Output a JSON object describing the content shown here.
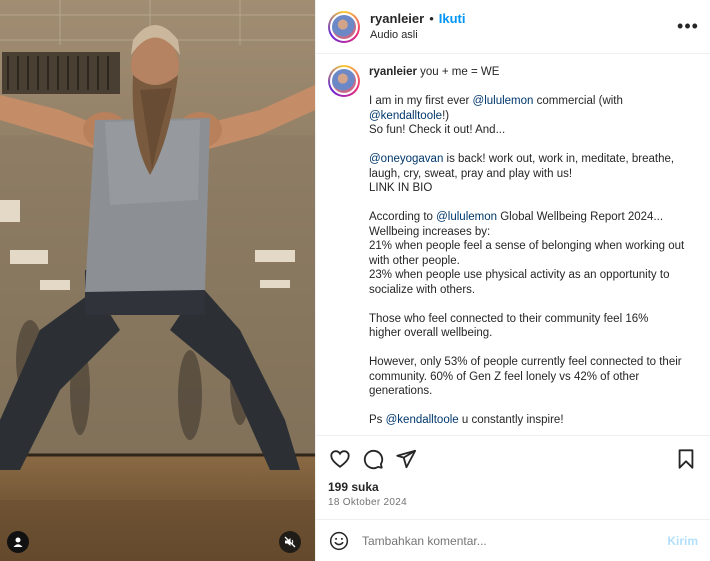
{
  "post": {
    "username": "ryanleier",
    "separator": "•",
    "follow_label": "Ikuti",
    "audio_label": "Audio asli",
    "more_label": "•••"
  },
  "caption": {
    "username": "ryanleier",
    "lines": [
      {
        "segments": [
          {
            "text": " you + me = WE",
            "type": "text"
          }
        ]
      },
      {
        "segments": [
          {
            "text": "",
            "type": "text"
          }
        ]
      },
      {
        "segments": [
          {
            "text": "I am in my first ever ",
            "type": "text"
          },
          {
            "text": "@lululemon",
            "type": "mention"
          },
          {
            "text": " commercial (with",
            "type": "text"
          }
        ]
      },
      {
        "segments": [
          {
            "text": "@kendalltoole",
            "type": "mention"
          },
          {
            "text": "!)",
            "type": "text"
          }
        ]
      },
      {
        "segments": [
          {
            "text": "So fun! Check it out! And...",
            "type": "text"
          }
        ]
      },
      {
        "segments": [
          {
            "text": "",
            "type": "text"
          }
        ]
      },
      {
        "segments": [
          {
            "text": "@oneyogavan",
            "type": "mention"
          },
          {
            "text": " is back! work out, work in, meditate, breathe,",
            "type": "text"
          }
        ]
      },
      {
        "segments": [
          {
            "text": "laugh, cry, sweat, pray and play with us!",
            "type": "text"
          }
        ]
      },
      {
        "segments": [
          {
            "text": "LINK IN BIO",
            "type": "text"
          }
        ]
      },
      {
        "segments": [
          {
            "text": "",
            "type": "text"
          }
        ]
      },
      {
        "segments": [
          {
            "text": "According to ",
            "type": "text"
          },
          {
            "text": "@lululemon",
            "type": "mention"
          },
          {
            "text": " Global Wellbeing Report 2024...",
            "type": "text"
          }
        ]
      },
      {
        "segments": [
          {
            "text": "Wellbeing increases by:",
            "type": "text"
          }
        ]
      },
      {
        "segments": [
          {
            "text": "21% when people feel a sense of belonging when working out",
            "type": "text"
          }
        ]
      },
      {
        "segments": [
          {
            "text": "with other people.",
            "type": "text"
          }
        ]
      },
      {
        "segments": [
          {
            "text": "23% when people use physical activity as an opportunity to",
            "type": "text"
          }
        ]
      },
      {
        "segments": [
          {
            "text": "socialize with others.",
            "type": "text"
          }
        ]
      },
      {
        "segments": [
          {
            "text": "",
            "type": "text"
          }
        ]
      },
      {
        "segments": [
          {
            "text": "Those who feel connected to their community feel 16%",
            "type": "text"
          }
        ]
      },
      {
        "segments": [
          {
            "text": "higher overall wellbeing.",
            "type": "text"
          }
        ]
      },
      {
        "segments": [
          {
            "text": "",
            "type": "text"
          }
        ]
      },
      {
        "segments": [
          {
            "text": "However, only 53% of people currently feel connected to their",
            "type": "text"
          }
        ]
      },
      {
        "segments": [
          {
            "text": "community. 60% of Gen Z feel lonely vs 42% of other",
            "type": "text"
          }
        ]
      },
      {
        "segments": [
          {
            "text": "generations.",
            "type": "text"
          }
        ]
      },
      {
        "segments": [
          {
            "text": "",
            "type": "text"
          }
        ]
      },
      {
        "segments": [
          {
            "text": "Ps ",
            "type": "text"
          },
          {
            "text": "@kendalltoole",
            "type": "mention"
          },
          {
            "text": " u constantly inspire!",
            "type": "text"
          }
        ]
      }
    ]
  },
  "actions": {
    "likes": "199 suka",
    "date": "18 Oktober 2024",
    "icons": [
      "heart-icon",
      "comment-icon",
      "share-icon",
      "bookmark-icon"
    ]
  },
  "comment": {
    "placeholder": "Tambahkan komentar...",
    "send_label": "Kirim"
  },
  "colors": {
    "accent": "#0095f6",
    "mention": "#00376b",
    "send_disabled": "#b2dffc"
  }
}
